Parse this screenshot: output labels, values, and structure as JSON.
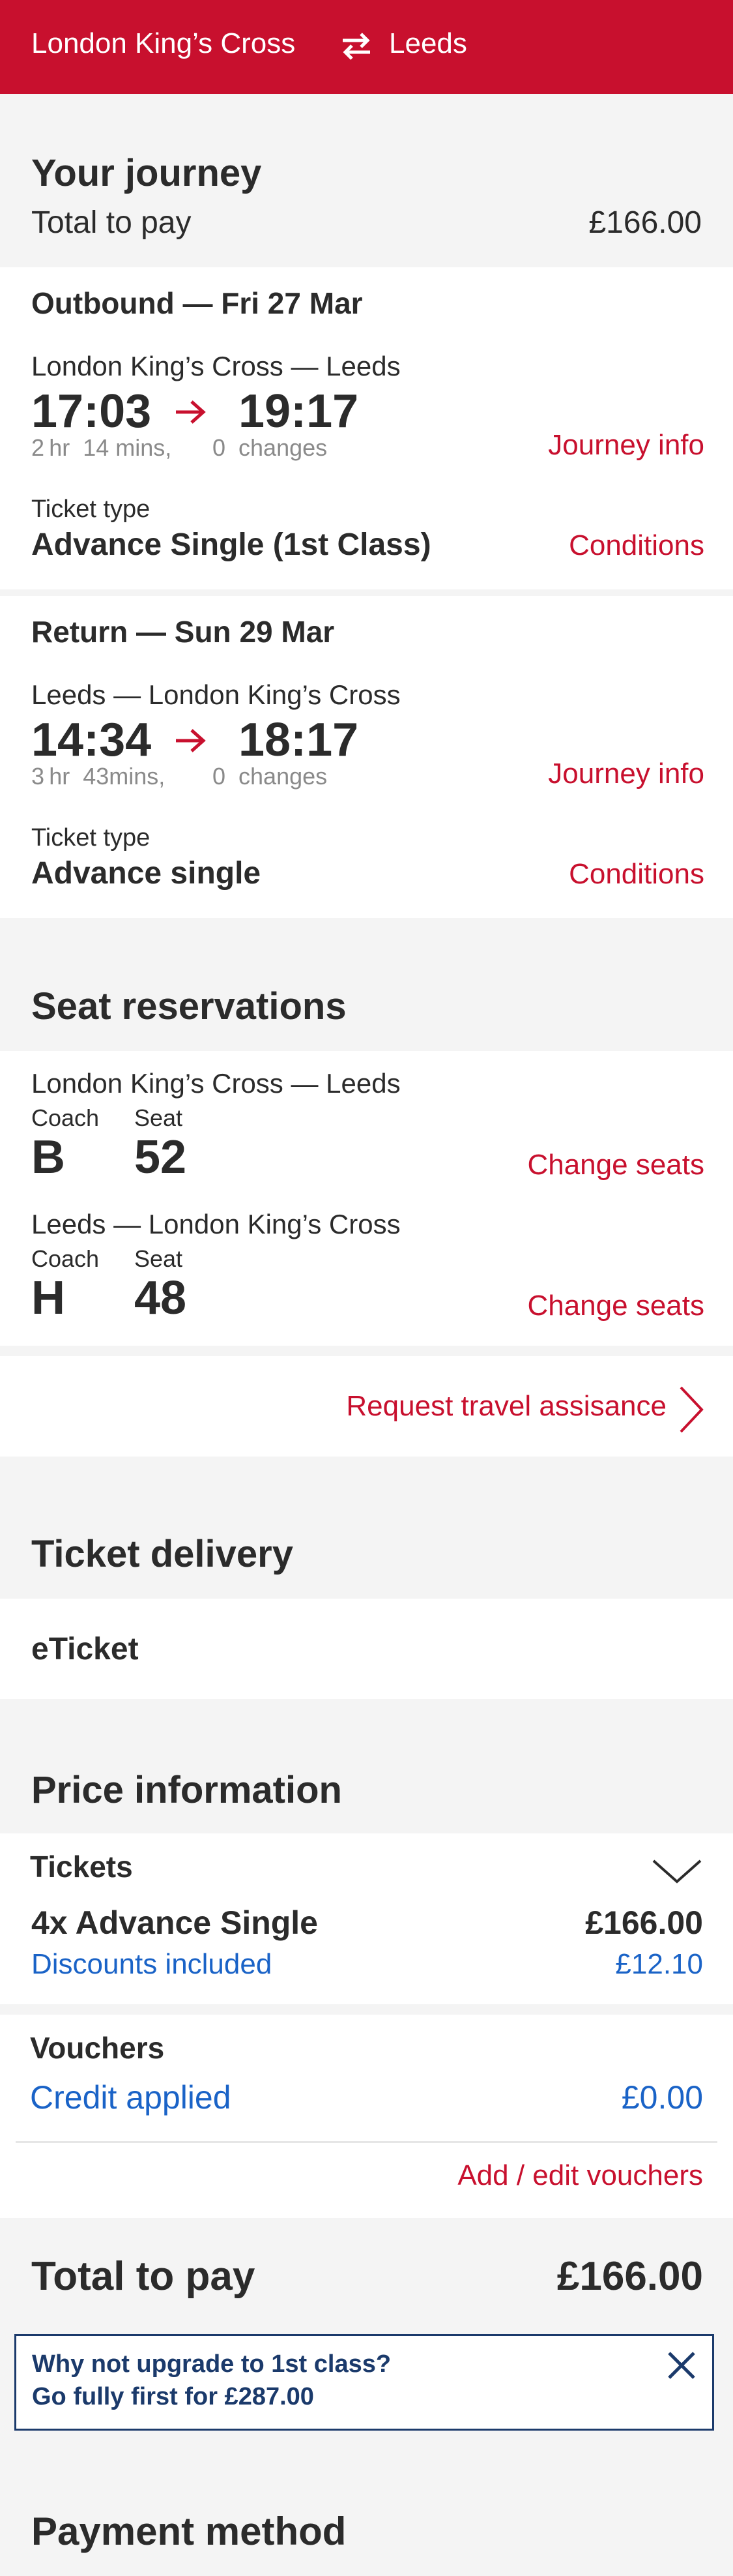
{
  "header": {
    "from": "London King’s Cross",
    "to": "Leeds",
    "bg": "#c8102e"
  },
  "journey": {
    "heading": "Your journey",
    "total_label": "Total to pay",
    "total_value": "£166.00"
  },
  "outbound": {
    "title": "Outbound — Fri 27 Mar",
    "route": "London King’s Cross — Leeds",
    "depart": "17:03",
    "arrive": "19:17",
    "duration": "2 hr  14 mins,",
    "changes": "0  changes",
    "journey_info": "Journey info",
    "ticket_type_label": "Ticket type",
    "ticket_type": "Advance Single (1st Class)",
    "conditions": "Conditions"
  },
  "return": {
    "title": "Return — Sun 29 Mar",
    "route": "Leeds — London King’s Cross",
    "depart": "14:34",
    "arrive": "18:17",
    "duration": "3 hr  43mins,",
    "changes": "0  changes",
    "journey_info": "Journey info",
    "ticket_type_label": "Ticket type",
    "ticket_type": "Advance single",
    "conditions": "Conditions"
  },
  "seats": {
    "heading": "Seat reservations",
    "coach_label": "Coach",
    "seat_label": "Seat",
    "change_label": "Change seats",
    "items": [
      {
        "route": "London King’s Cross — Leeds",
        "coach": "B",
        "seat": "52"
      },
      {
        "route": "Leeds — London King’s Cross",
        "coach": "H",
        "seat": "48"
      }
    ]
  },
  "assistance": {
    "label": "Request travel assisance"
  },
  "delivery": {
    "heading": "Ticket delivery",
    "method": "eTicket"
  },
  "price": {
    "heading": "Price information",
    "tickets_label": "Tickets",
    "ticket_line": "4x Advance Single",
    "ticket_amount": "£166.00",
    "discounts_label": "Discounts included",
    "discounts_amount": "£12.10",
    "vouchers_label": "Vouchers",
    "credit_label": "Credit applied",
    "credit_amount": "£0.00",
    "edit_vouchers": "Add / edit vouchers"
  },
  "total": {
    "label": "Total to pay",
    "value": "£166.00"
  },
  "upgrade": {
    "line1": "Why not upgrade to 1st class?",
    "line2": "Go fully first for £287.00"
  },
  "payment": {
    "heading": "Payment method"
  }
}
